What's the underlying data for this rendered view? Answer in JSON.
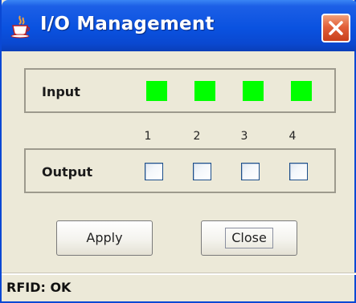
{
  "window": {
    "title": "I/O Management",
    "icon": "java-cup-icon",
    "close_icon": "close-icon"
  },
  "input_group": {
    "label": "Input",
    "leds": [
      {
        "channel": 1,
        "state": "on",
        "color": "#00ff00"
      },
      {
        "channel": 2,
        "state": "on",
        "color": "#00ff00"
      },
      {
        "channel": 3,
        "state": "on",
        "color": "#00ff00"
      },
      {
        "channel": 4,
        "state": "on",
        "color": "#00ff00"
      }
    ]
  },
  "channel_numbers": [
    "1",
    "2",
    "3",
    "4"
  ],
  "output_group": {
    "label": "Output",
    "checkboxes": [
      {
        "channel": 1,
        "checked": false
      },
      {
        "channel": 2,
        "checked": false
      },
      {
        "channel": 3,
        "checked": false
      },
      {
        "channel": 4,
        "checked": false
      }
    ]
  },
  "buttons": {
    "apply_label": "Apply",
    "close_label": "Close"
  },
  "status": {
    "text": "RFID: OK"
  },
  "colors": {
    "titlebar": "#0a52e0",
    "window_bg": "#ece9d8",
    "led_on": "#00ff00"
  }
}
